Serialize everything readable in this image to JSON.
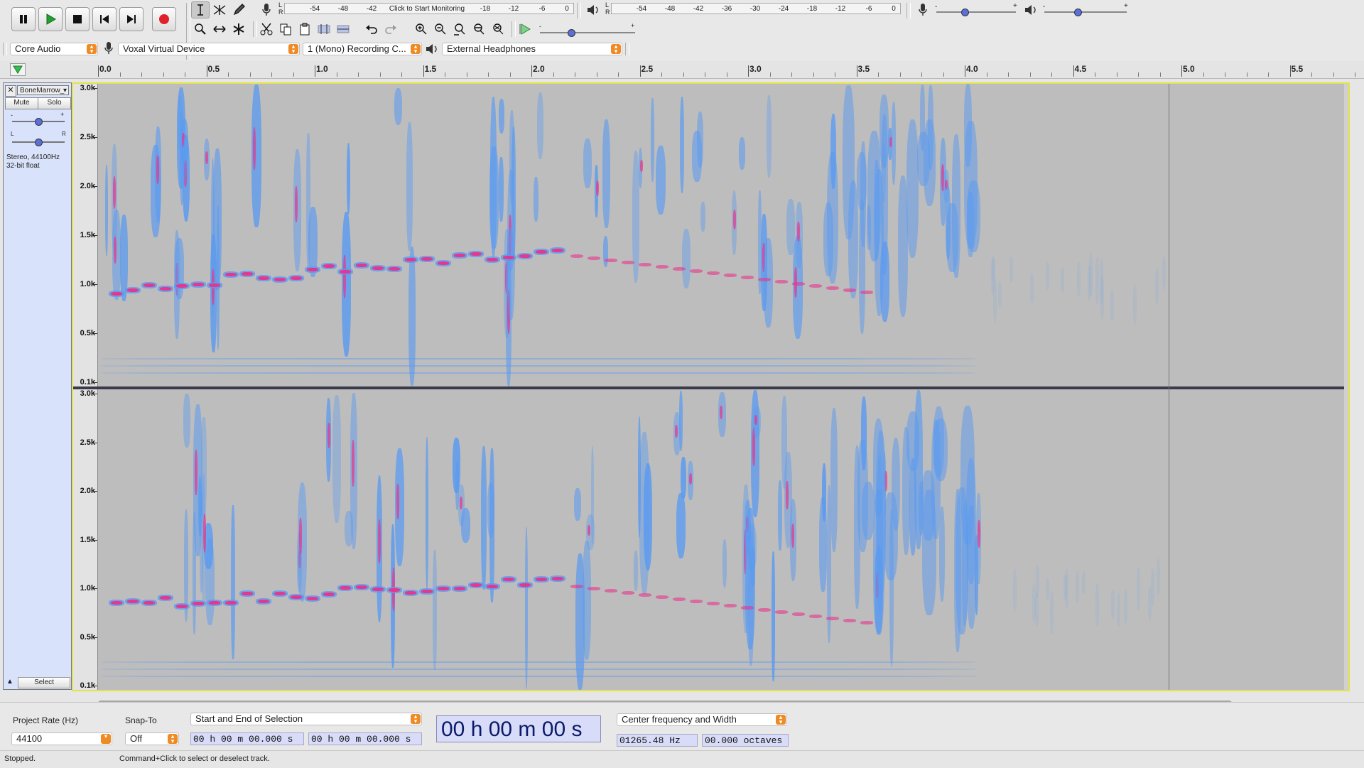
{
  "transport": {
    "buttons": [
      "pause",
      "play",
      "stop",
      "skip-start",
      "skip-end",
      "record"
    ]
  },
  "meters": {
    "record_meter": {
      "channels": [
        "L",
        "R"
      ],
      "ticks": [
        "-54",
        "-48",
        "-42",
        "-18",
        "-12",
        "-6",
        "0"
      ],
      "click_text": "Click to Start Monitoring"
    },
    "playback_meter": {
      "channels": [
        "L",
        "R"
      ],
      "ticks": [
        "-54",
        "-48",
        "-42",
        "-36",
        "-30",
        "-24",
        "-18",
        "-12",
        "-6",
        "0"
      ]
    },
    "record_volume": {
      "min": "-",
      "max": "+",
      "level": 0.35
    },
    "playback_volume": {
      "min": "-",
      "max": "+",
      "level": 0.4
    },
    "play_at_speed_level": 0.32
  },
  "device": {
    "host": "Core Audio",
    "recording_device": "Voxal Virtual Device",
    "recording_channels": "1 (Mono) Recording C...",
    "playback_device": "External Headphones"
  },
  "ruler": {
    "labels": [
      "0.0",
      "0.5",
      "1.0",
      "1.5",
      "2.0",
      "2.5",
      "3.0",
      "3.5",
      "4.0",
      "4.5",
      "5.0",
      "5.5"
    ]
  },
  "track": {
    "name": "BoneMarrow_",
    "mute_label": "Mute",
    "solo_label": "Solo",
    "gain_min": "-",
    "gain_max": "+",
    "pan_left": "L",
    "pan_right": "R",
    "info_line1": "Stereo, 44100Hz",
    "info_line2": "32-bit float",
    "select_label": "Select",
    "freq_labels": [
      "3.0k",
      "2.5k",
      "2.0k",
      "1.5k",
      "1.0k",
      "0.5k",
      "0.1k"
    ]
  },
  "selection_bar": {
    "project_rate_label": "Project Rate (Hz)",
    "project_rate_value": "44100",
    "snap_to_label": "Snap-To",
    "snap_to_value": "Off",
    "selection_mode": "Start and End of Selection",
    "sel_start": "00 h 00 m 00.000 s",
    "sel_end": "00 h 00 m 00.000 s",
    "audio_position": "00 h 00 m 00 s",
    "spectral_mode": "Center frequency and Width",
    "center_freq": "01265.48",
    "center_unit": "Hz",
    "width": "00.000",
    "width_unit": "octaves"
  },
  "status": {
    "state": "Stopped.",
    "hint": "Command+Click to select or deselect track."
  },
  "colors": {
    "spectrogram_bg": "#bdbdbd",
    "blue": "#5a9af0",
    "magenta": "#e8338a",
    "selection_border": "#e4e34a",
    "track_panel": "#d8e2fa"
  }
}
